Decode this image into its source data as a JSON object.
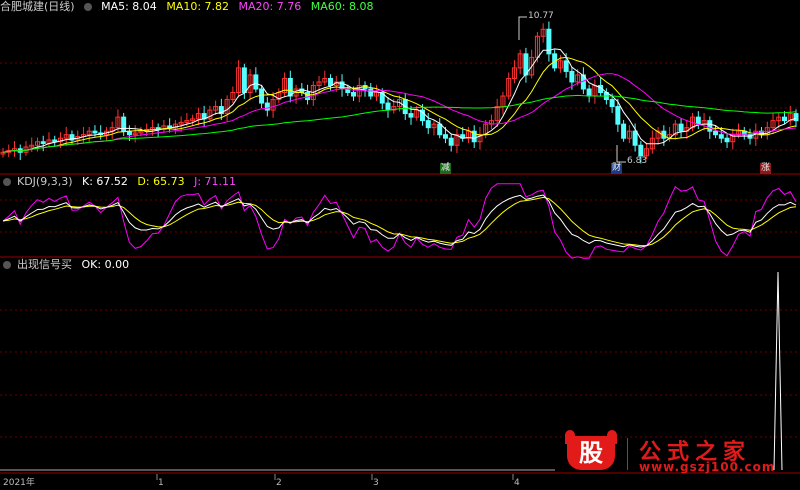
{
  "main_header": {
    "title": "合肥城建(日线)",
    "ma5": "MA5: 8.04",
    "ma10": "MA10: 7.82",
    "ma20": "MA20: 7.76",
    "ma60": "MA60: 8.08"
  },
  "kdj_header": {
    "title": "KDJ(9,3,3)",
    "k": "K: 67.52",
    "d": "D: 65.73",
    "j": "J: 71.11"
  },
  "signal_header": {
    "title": "出现信号买",
    "ok": "OK: 0.00"
  },
  "price_high_label": "10.77",
  "price_low_label": "6.83",
  "markers": [
    "减",
    "财",
    "涨"
  ],
  "x_axis": [
    "2021年",
    "1",
    "2",
    "3",
    "4"
  ],
  "watermark": {
    "brand_char": "股",
    "name": "公式之家",
    "url": "www.gszj100.com"
  },
  "colors": {
    "up": "#ff3232",
    "down": "#54ffff",
    "ma5": "#ffffff",
    "ma10": "#ffff00",
    "ma20": "#ff00ff",
    "ma60": "#00ff00",
    "grid": "#6e0000",
    "kdj_k": "#ffffff",
    "kdj_d": "#ffff00",
    "kdj_j": "#ff00ff"
  },
  "chart_data": [
    {
      "type": "candlestick",
      "title": "合肥城建(日线)",
      "series": [
        {
          "name": "MA5",
          "last": 8.04
        },
        {
          "name": "MA10",
          "last": 7.82
        },
        {
          "name": "MA20",
          "last": 7.76
        },
        {
          "name": "MA60",
          "last": 8.08
        }
      ],
      "close": [
        7.0,
        7.05,
        7.1,
        7.0,
        7.15,
        7.2,
        7.3,
        7.25,
        7.35,
        7.3,
        7.4,
        7.5,
        7.35,
        7.45,
        7.5,
        7.6,
        7.55,
        7.5,
        7.6,
        7.7,
        8.0,
        7.6,
        7.5,
        7.55,
        7.6,
        7.65,
        7.7,
        7.65,
        7.75,
        7.7,
        7.8,
        7.85,
        7.9,
        7.95,
        8.1,
        7.95,
        8.2,
        8.3,
        8.1,
        8.5,
        8.7,
        9.4,
        8.7,
        9.2,
        8.8,
        8.4,
        8.2,
        8.5,
        8.7,
        9.1,
        8.6,
        8.8,
        8.7,
        8.5,
        8.9,
        9.0,
        9.1,
        8.9,
        9.0,
        8.8,
        8.7,
        8.6,
        8.9,
        8.8,
        8.6,
        8.7,
        8.4,
        8.2,
        8.3,
        8.5,
        8.1,
        8.0,
        8.2,
        7.9,
        7.7,
        7.8,
        7.5,
        7.4,
        7.2,
        7.5,
        7.4,
        7.6,
        7.3,
        7.5,
        7.8,
        7.9,
        8.3,
        8.6,
        9.1,
        9.4,
        9.8,
        9.2,
        9.7,
        10.3,
        10.5,
        9.8,
        9.4,
        9.6,
        9.3,
        9.0,
        9.2,
        8.8,
        8.6,
        8.9,
        8.7,
        8.5,
        8.3,
        7.8,
        7.4,
        7.6,
        7.2,
        6.9,
        7.1,
        7.4,
        7.6,
        7.4,
        7.5,
        7.8,
        7.6,
        7.7,
        8.0,
        7.8,
        7.9,
        7.6,
        7.5,
        7.4,
        7.3,
        7.5,
        7.6,
        7.5,
        7.4,
        7.6,
        7.5,
        7.7,
        7.9,
        8.0,
        7.9,
        8.1,
        7.9
      ],
      "high": 10.77,
      "low": 6.83
    },
    {
      "type": "line",
      "title": "KDJ(9,3,3)",
      "series": [
        {
          "name": "K",
          "last": 67.52
        },
        {
          "name": "D",
          "last": 65.73
        },
        {
          "name": "J",
          "last": 71.11
        }
      ]
    },
    {
      "type": "line",
      "title": "出现信号买",
      "series": [
        {
          "name": "OK",
          "last": 0.0
        }
      ]
    }
  ]
}
